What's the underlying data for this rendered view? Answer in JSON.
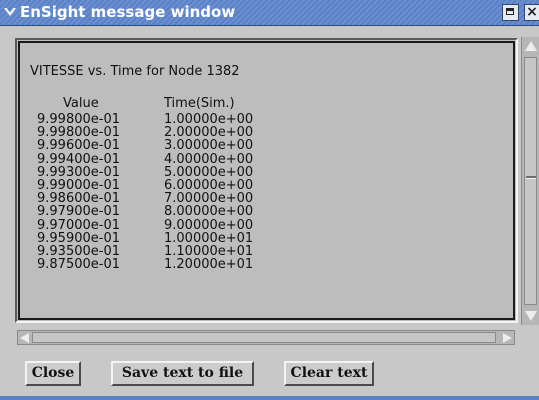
{
  "window": {
    "title": "EnSight message window"
  },
  "message": {
    "heading": "VITESSE vs. Time for Node 1382",
    "columns": [
      "Value",
      "Time(Sim.)"
    ],
    "rows": [
      [
        "9.99800e-01",
        "1.00000e+00"
      ],
      [
        "9.99800e-01",
        "2.00000e+00"
      ],
      [
        "9.99600e-01",
        "3.00000e+00"
      ],
      [
        "9.99400e-01",
        "4.00000e+00"
      ],
      [
        "9.99300e-01",
        "5.00000e+00"
      ],
      [
        "9.99000e-01",
        "6.00000e+00"
      ],
      [
        "9.98600e-01",
        "7.00000e+00"
      ],
      [
        "9.97900e-01",
        "8.00000e+00"
      ],
      [
        "9.97000e-01",
        "9.00000e+00"
      ],
      [
        "9.95900e-01",
        "1.00000e+01"
      ],
      [
        "9.93500e-01",
        "1.10000e+01"
      ],
      [
        "9.87500e-01",
        "1.20000e+01"
      ]
    ]
  },
  "buttons": {
    "close": "Close",
    "save": "Save text to file",
    "clear": "Clear text"
  },
  "colors": {
    "titlebar": "#5b80c4",
    "background": "#c8c8c8",
    "text_area": "#bdbdbd"
  },
  "icons": {
    "window_menu": "chevron-down-icon",
    "maximize": "maximize-icon",
    "close": "close-icon"
  }
}
